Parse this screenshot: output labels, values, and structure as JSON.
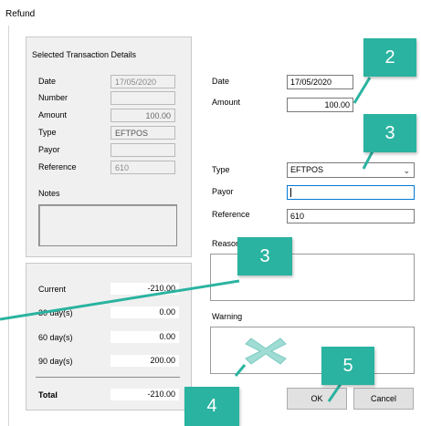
{
  "window": {
    "title": "Refund"
  },
  "selected": {
    "heading": "Selected Transaction Details",
    "rows": [
      {
        "label": "Date",
        "value": "17/05/2020"
      },
      {
        "label": "Number",
        "value": ""
      },
      {
        "label": "Amount",
        "value": "100.00"
      },
      {
        "label": "Type",
        "value": "EFTPOS"
      },
      {
        "label": "Payor",
        "value": ""
      },
      {
        "label": "Reference",
        "value": "610"
      }
    ],
    "notes_label": "Notes"
  },
  "aging": {
    "rows": [
      {
        "label": "Current",
        "value": "-210.00"
      },
      {
        "label": "30 day(s)",
        "value": "0.00"
      },
      {
        "label": "60 day(s)",
        "value": "0.00"
      },
      {
        "label": "90 day(s)",
        "value": "200.00"
      }
    ],
    "total_label": "Total",
    "total_value": "-210.00"
  },
  "form": {
    "date_label": "Date",
    "date_value": "17/05/2020",
    "amount_label": "Amount",
    "amount_value": "100.00",
    "type_label": "Type",
    "type_value": "EFTPOS",
    "payor_label": "Payor",
    "payor_value": "",
    "reference_label": "Reference",
    "reference_value": "610",
    "reason_label": "Reason",
    "warning_label": "Warning"
  },
  "buttons": {
    "ok": "OK",
    "cancel": "Cancel"
  },
  "callouts": [
    "2",
    "3",
    "3",
    "4",
    "5"
  ],
  "colors": {
    "callout": "#2ab3a0",
    "pointer": "#2ab3a0"
  },
  "icons": {
    "dropdown": "chevron-down-icon",
    "clear": "close-icon"
  }
}
